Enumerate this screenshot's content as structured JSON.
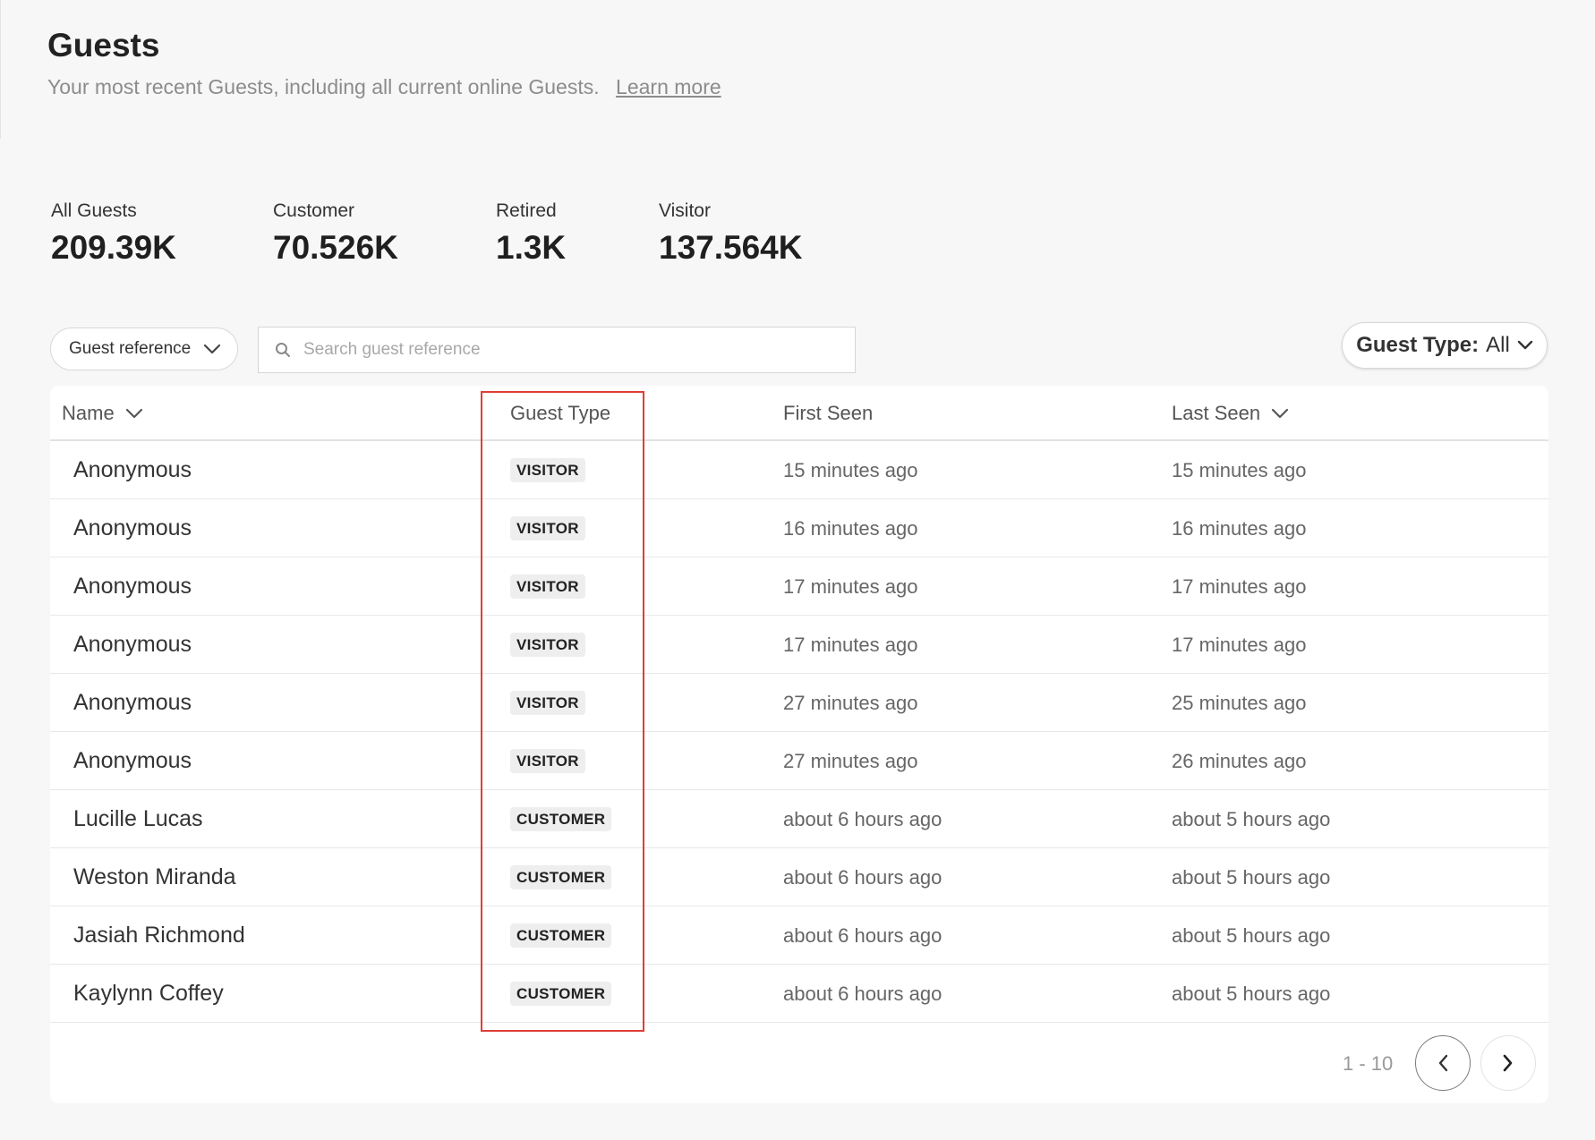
{
  "page": {
    "title": "Guests",
    "subtitle": "Your most recent Guests, including all current online Guests.",
    "learn_more": "Learn more"
  },
  "stats": [
    {
      "label": "All Guests",
      "value": "209.39K"
    },
    {
      "label": "Customer",
      "value": "70.526K"
    },
    {
      "label": "Retired",
      "value": "1.3K"
    },
    {
      "label": "Visitor",
      "value": "137.564K"
    }
  ],
  "filters": {
    "reference_select": "Guest reference",
    "search_placeholder": "Search guest reference",
    "guest_type_label": "Guest Type:",
    "guest_type_value": "All"
  },
  "table": {
    "columns": [
      "Name",
      "Guest Type",
      "First Seen",
      "Last Seen"
    ],
    "rows": [
      {
        "name": "Anonymous",
        "type": "VISITOR",
        "first_seen": "15 minutes ago",
        "last_seen": "15 minutes ago"
      },
      {
        "name": "Anonymous",
        "type": "VISITOR",
        "first_seen": "16 minutes ago",
        "last_seen": "16 minutes ago"
      },
      {
        "name": "Anonymous",
        "type": "VISITOR",
        "first_seen": "17 minutes ago",
        "last_seen": "17 minutes ago"
      },
      {
        "name": "Anonymous",
        "type": "VISITOR",
        "first_seen": "17 minutes ago",
        "last_seen": "17 minutes ago"
      },
      {
        "name": "Anonymous",
        "type": "VISITOR",
        "first_seen": "27 minutes ago",
        "last_seen": "25 minutes ago"
      },
      {
        "name": "Anonymous",
        "type": "VISITOR",
        "first_seen": "27 minutes ago",
        "last_seen": "26 minutes ago"
      },
      {
        "name": "Lucille Lucas",
        "type": "CUSTOMER",
        "first_seen": "about 6 hours ago",
        "last_seen": "about 5 hours ago"
      },
      {
        "name": "Weston Miranda",
        "type": "CUSTOMER",
        "first_seen": "about 6 hours ago",
        "last_seen": "about 5 hours ago"
      },
      {
        "name": "Jasiah Richmond",
        "type": "CUSTOMER",
        "first_seen": "about 6 hours ago",
        "last_seen": "about 5 hours ago"
      },
      {
        "name": "Kaylynn Coffey",
        "type": "CUSTOMER",
        "first_seen": "about 6 hours ago",
        "last_seen": "about 5 hours ago"
      }
    ]
  },
  "pagination": {
    "range": "1 - 10"
  },
  "colors": {
    "highlight": "#e03e36",
    "badge_bg": "#eeeeee",
    "background": "#f7f7f7"
  },
  "icons": {
    "column_sort": "chevron-down-icon",
    "search": "search-icon",
    "prev": "chevron-left-icon",
    "next": "chevron-right-icon"
  }
}
